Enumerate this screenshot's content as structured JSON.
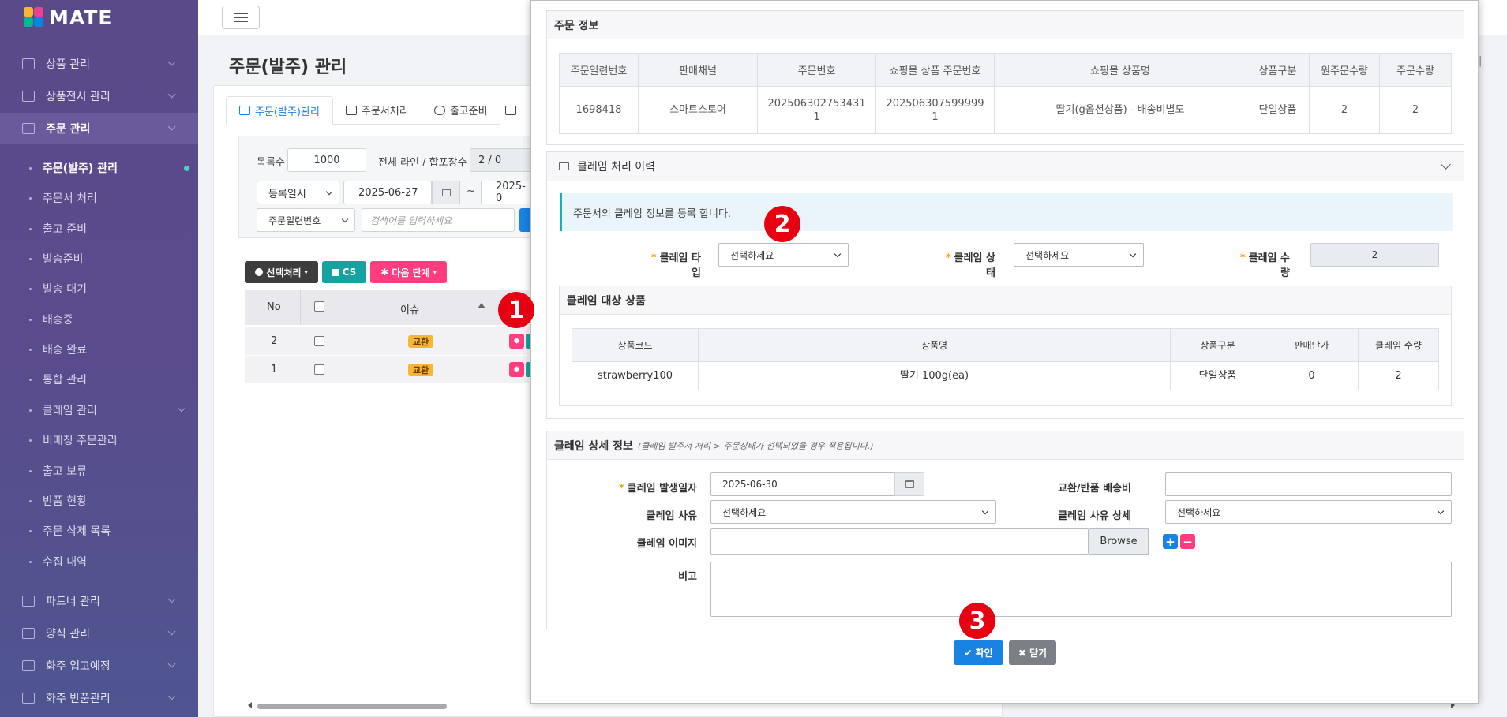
{
  "app": {
    "logo_text": "MATE"
  },
  "sidebar": {
    "top_items": [
      {
        "label": "상품 관리"
      },
      {
        "label": "상품전시 관리"
      },
      {
        "label": "주문 관리"
      }
    ],
    "sub_items": [
      {
        "label": "주문(발주) 관리"
      },
      {
        "label": "주문서 처리"
      },
      {
        "label": "출고 준비"
      },
      {
        "label": "발송준비"
      },
      {
        "label": "발송 대기"
      },
      {
        "label": "배송중"
      },
      {
        "label": "배송 완료"
      },
      {
        "label": "통합 관리"
      },
      {
        "label": "클레임 관리"
      },
      {
        "label": "비매칭 주문관리"
      },
      {
        "label": "출고 보류"
      },
      {
        "label": "반품 현황"
      },
      {
        "label": "주문 삭제 목록"
      },
      {
        "label": "수집 내역"
      }
    ],
    "bottom_items": [
      {
        "label": "파트너 관리"
      },
      {
        "label": "양식 관리"
      },
      {
        "label": "화주 입고예정"
      },
      {
        "label": "화주 반품관리"
      }
    ]
  },
  "page": {
    "title": "주문(발주) 관리"
  },
  "tabs": [
    {
      "label": "주문(발주)관리"
    },
    {
      "label": "주문서처리"
    },
    {
      "label": "출고준비"
    }
  ],
  "filter": {
    "list_count_label": "목록수",
    "list_count_value": "1000",
    "total_label": "전체 라인 / 합포장수",
    "total_value": "2 / 0",
    "date_type": "등록일시",
    "date_from": "2025-06-27",
    "tilde": "~",
    "date_to": "2025-0",
    "search_type": "주문일련번호",
    "search_placeholder": "검색어를 입력하세요"
  },
  "toolbar": {
    "select_process": "선택처리",
    "cs": "CS",
    "next_step": "다음 단계"
  },
  "grid": {
    "headers": {
      "no": "No",
      "issue": "이슈"
    },
    "rows": [
      {
        "no": "2",
        "issue": "교환"
      },
      {
        "no": "1",
        "issue": "교환"
      }
    ]
  },
  "modal": {
    "order_info": {
      "title": "주문 정보",
      "headers": [
        "주문일련번호",
        "판매채널",
        "주문번호",
        "쇼핑몰 상품 주문번호",
        "쇼핑몰 상품명",
        "상품구분",
        "원주문수량",
        "주문수량"
      ],
      "row": [
        "1698418",
        "스마트스토어",
        "2025063027534311",
        "2025063075999991",
        "딸기(g옵션상품) - 배송비별도",
        "단일상품",
        "2",
        "2"
      ]
    },
    "claim_history": {
      "title": "클레임 처리 이력"
    },
    "notice": "주문서의 클레임 정보를 등록 합니다.",
    "claim_type": {
      "label": "클레임 타입",
      "value": "선택하세요"
    },
    "claim_status": {
      "label": "클레임 상태",
      "value": "선택하세요"
    },
    "claim_qty": {
      "label": "클레임 수량",
      "value": "2"
    },
    "claim_products": {
      "title": "클레임 대상 상품",
      "headers": [
        "상품코드",
        "상품명",
        "상품구분",
        "판매단가",
        "클레임 수량"
      ],
      "row": [
        "strawberry100",
        "딸기 100g(ea)",
        "단일상품",
        "0",
        "2"
      ]
    },
    "claim_detail": {
      "title": "클레임 상세 정보",
      "subtitle": "(클레임 발주서 처리 > 주문상태가 선택되었을 경우 적용됩니다.)",
      "date_label": "클레임 발생일자",
      "date_value": "2025-06-30",
      "shipping_label": "교환/반품 배송비",
      "shipping_value": "",
      "reason_label": "클레임 사유",
      "reason_value": "선택하세요",
      "reason_detail_label": "클레임 사유 상세",
      "reason_detail_value": "선택하세요",
      "image_label": "클레임 이미지",
      "browse": "Browse",
      "memo_label": "비고"
    },
    "confirm": "확인",
    "close": "닫기"
  },
  "markers": [
    "1",
    "2",
    "3"
  ],
  "colors": {
    "sidebar": "#5a4a8a",
    "accent": "#1a82e2",
    "pink": "#ff3d7f",
    "teal": "#17a2a2",
    "marker": "#e60012"
  }
}
